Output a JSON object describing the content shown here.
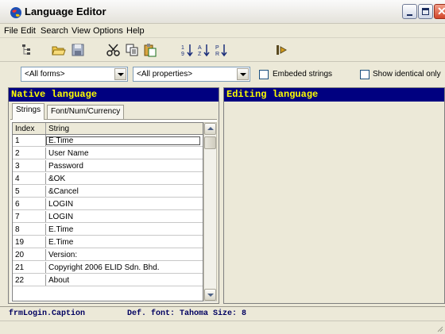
{
  "window": {
    "title": "Language Editor"
  },
  "menu": [
    "File",
    "Edit",
    "Search",
    "View",
    "Options",
    "Help"
  ],
  "toolbar_icons": [
    "tree-icon",
    "open-folder-icon",
    "save-disk-icon",
    "cut-icon",
    "copy-icon",
    "paste-icon",
    "sort-numeric-icon",
    "sort-alpha-icon",
    "sort-custom-icon",
    "run-icon"
  ],
  "filters": {
    "forms_value": "<All forms>",
    "properties_value": "<All properties>",
    "embedded_label": "Embeded strings",
    "embedded_checked": false,
    "identical_label": "Show identical only",
    "identical_checked": false
  },
  "native": {
    "header": "Native language",
    "tabs": [
      "Strings",
      "Font/Num/Currency"
    ],
    "active_tab": "Strings",
    "columns": [
      "Index",
      "String"
    ],
    "rows": [
      {
        "index": "1",
        "string": "E.Time",
        "selected": true
      },
      {
        "index": "2",
        "string": "User Name"
      },
      {
        "index": "3",
        "string": "Password"
      },
      {
        "index": "4",
        "string": "&OK"
      },
      {
        "index": "5",
        "string": "&Cancel"
      },
      {
        "index": "6",
        "string": "LOGIN"
      },
      {
        "index": "7",
        "string": "LOGIN"
      },
      {
        "index": "8",
        "string": "E.Time"
      },
      {
        "index": "19",
        "string": "E.Time"
      },
      {
        "index": "20",
        "string": "Version:"
      },
      {
        "index": "21",
        "string": "Copyright 2006 ELID Sdn. Bhd."
      },
      {
        "index": "22",
        "string": "About"
      }
    ]
  },
  "editing": {
    "header": "Editing language"
  },
  "status": {
    "property": "frmLogin.Caption",
    "font": "Def. font: Tahoma Size: 8"
  },
  "colors": {
    "pane_header_bg": "#000080",
    "pane_header_text": "#ffff00"
  }
}
